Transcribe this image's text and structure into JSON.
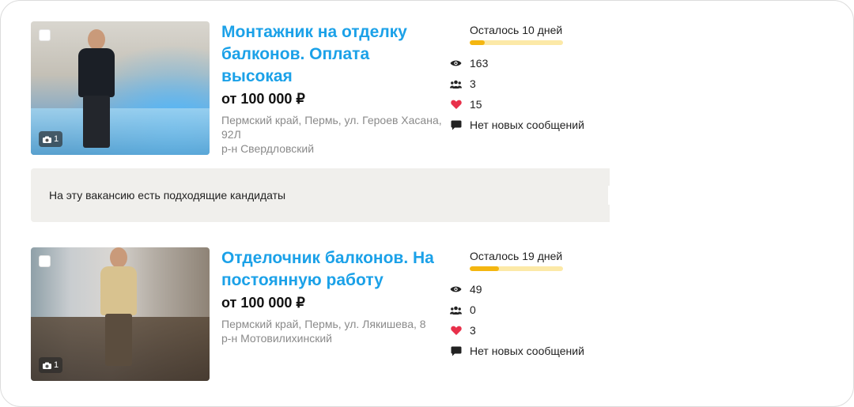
{
  "listings": [
    {
      "title": "Монтажник на отделку балконов. Оплата высокая",
      "price": "от 100 000 ₽",
      "address": "Пермский край, Пермь, ул. Героев Хасана, 92Л",
      "district": "р-н Свердловский",
      "photo_count": "1",
      "days_left": "Осталось 10 дней",
      "days_progress_fraction": 0.16,
      "views": "163",
      "responses": "3",
      "favorites": "15",
      "messages": "Нет новых сообщений"
    },
    {
      "title": "Отделочник балконов. На постоянную работу",
      "price": "от 100 000 ₽",
      "address": "Пермский край, Пермь, ул. Лякишева, 8",
      "district": "р-н Мотовилихинский",
      "photo_count": "1",
      "days_left": "Осталось 19 дней",
      "days_progress_fraction": 0.31,
      "views": "49",
      "responses": "0",
      "favorites": "3",
      "messages": "Нет новых сообщений"
    }
  ],
  "notice": {
    "text": "На эту вакансию есть подходящие кандидаты"
  },
  "colors": {
    "title_link": "#1ba1e8",
    "progress_fill": "#f4b610",
    "progress_track": "#fce9a7",
    "heart": "#e8304a",
    "notice_bg": "#f0efec"
  },
  "icons": {
    "views": "eye-icon",
    "responses": "people-icon",
    "favorites": "heart-icon",
    "messages": "chat-bubble-icon",
    "photo": "camera-icon"
  }
}
